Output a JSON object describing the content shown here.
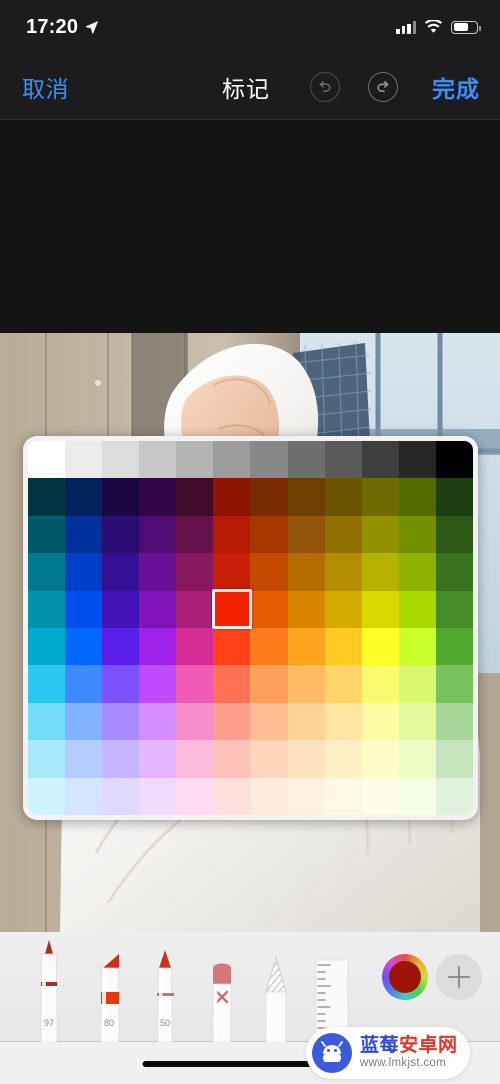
{
  "statusbar": {
    "time": "17:20",
    "location_icon": "location-arrow-icon",
    "signal_icon": "cellular-signal-icon",
    "wifi_icon": "wifi-icon",
    "battery_icon": "battery-icon",
    "battery_level_pct": 68
  },
  "navbar": {
    "cancel_label": "取消",
    "title": "标记",
    "undo_icon": "undo-icon",
    "redo_icon": "redo-icon",
    "done_label": "完成",
    "accent_color": "#3b8ff7",
    "background_color": "#1c1c1e"
  },
  "canvas": {
    "background_color": "#141414",
    "photo_description": "person-in-white-fleece-hoodie"
  },
  "palette": {
    "selected_color": "#c81e07",
    "selected_row": 4,
    "selected_col": 6,
    "background_color": "#f2f2f2",
    "columns": 12,
    "rows": 10,
    "swatches": [
      [
        "#ffffff",
        "#ececec",
        "#dcdcdc",
        "#c8c8c8",
        "#b4b4b4",
        "#9c9c9c",
        "#888888",
        "#6e6e6e",
        "#5a5a5a",
        "#3f3f3f",
        "#262626",
        "#000000"
      ],
      [
        "#02343f",
        "#00235e",
        "#1b0744",
        "#33064a",
        "#420a2a",
        "#8f1400",
        "#7a2a00",
        "#6d3f00",
        "#6b5400",
        "#6d6b00",
        "#536b00",
        "#1e3f12"
      ],
      [
        "#01596b",
        "#00319a",
        "#2a0c72",
        "#4f0d73",
        "#66124a",
        "#b61a00",
        "#a53800",
        "#94550a",
        "#8f7000",
        "#949100",
        "#729000",
        "#2d5a19"
      ],
      [
        "#00788e",
        "#0040c8",
        "#360f97",
        "#690f98",
        "#8a1860",
        "#c81e07",
        "#c34a00",
        "#b56d00",
        "#b38e00",
        "#b6b300",
        "#8db300",
        "#3a7320"
      ],
      [
        "#0092ab",
        "#0050f0",
        "#4313b8",
        "#8113bb",
        "#ab1e78",
        "#f32200",
        "#e85c00",
        "#d98500",
        "#d5ab00",
        "#dbd700",
        "#a9d700",
        "#468c27"
      ],
      [
        "#00aace",
        "#0067ff",
        "#5a1ce8",
        "#a021ea",
        "#d42c96",
        "#ff4217",
        "#ff7b1b",
        "#ffa31f",
        "#ffcb22",
        "#ffff2a",
        "#c8ff2d",
        "#53aa2f"
      ],
      [
        "#2bc6f2",
        "#3d8bff",
        "#7c52ff",
        "#c04bff",
        "#ef5bb4",
        "#ff7256",
        "#ff9f5c",
        "#ffbb63",
        "#ffd56a",
        "#fbfa6f",
        "#d8f96e",
        "#79c25e"
      ],
      [
        "#72dcf8",
        "#83b2ff",
        "#a98aff",
        "#d58cff",
        "#f68fc9",
        "#ff9f90",
        "#ffbd94",
        "#ffd29a",
        "#ffe4a2",
        "#fdfba3",
        "#e4fa9f",
        "#a6d699"
      ],
      [
        "#a5e9fb",
        "#b3cdff",
        "#c8b5ff",
        "#e4b6ff",
        "#fabbdd",
        "#ffc2b8",
        "#ffd6bb",
        "#ffe3c0",
        "#fff0c6",
        "#fefdc8",
        "#eefcc5",
        "#c6e5bd"
      ],
      [
        "#cef3fd",
        "#d6e5ff",
        "#e2d9ff",
        "#f0daff",
        "#fcdcee",
        "#ffe0dc",
        "#ffebde",
        "#fff2e2",
        "#fff8e6",
        "#fffee8",
        "#f6fee6",
        "#e0f1dd"
      ]
    ]
  },
  "toolbar": {
    "background_color": "#ebebeb",
    "tools": [
      {
        "name": "pen-tool",
        "label": "97",
        "color": "#b33020"
      },
      {
        "name": "highlighter-tool",
        "label": "80",
        "color": "#e03a16"
      },
      {
        "name": "pencil-tool",
        "label": "50",
        "color": "#c8341e"
      },
      {
        "name": "eraser-tool",
        "label": "",
        "color": "#d0777c"
      },
      {
        "name": "lasso-tool",
        "label": "",
        "color": "#b8b8b8"
      },
      {
        "name": "ruler-tool",
        "label": "",
        "color": "#c4c4c4"
      }
    ],
    "color_well": {
      "name": "color-wheel-button",
      "selected": "#9d1508"
    },
    "add_button_label": "+"
  },
  "home_indicator": {
    "name": "home-indicator"
  },
  "watermark": {
    "cn_part1": "蓝莓",
    "cn_part2": "安卓网",
    "url": "www.lmkjst.com",
    "logo_icon": "android-robot-icon"
  }
}
